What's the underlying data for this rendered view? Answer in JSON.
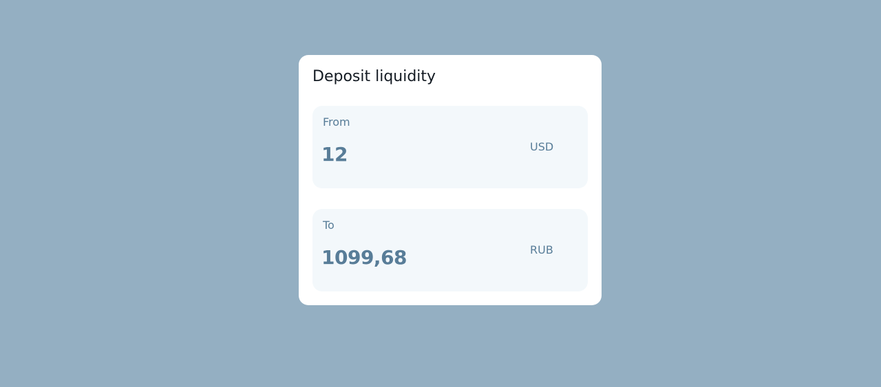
{
  "card": {
    "title": "Deposit liquidity"
  },
  "from": {
    "label": "From",
    "value": "12",
    "currency": "USD"
  },
  "to": {
    "label": "To",
    "value": "1099,68",
    "currency": "RUB"
  }
}
